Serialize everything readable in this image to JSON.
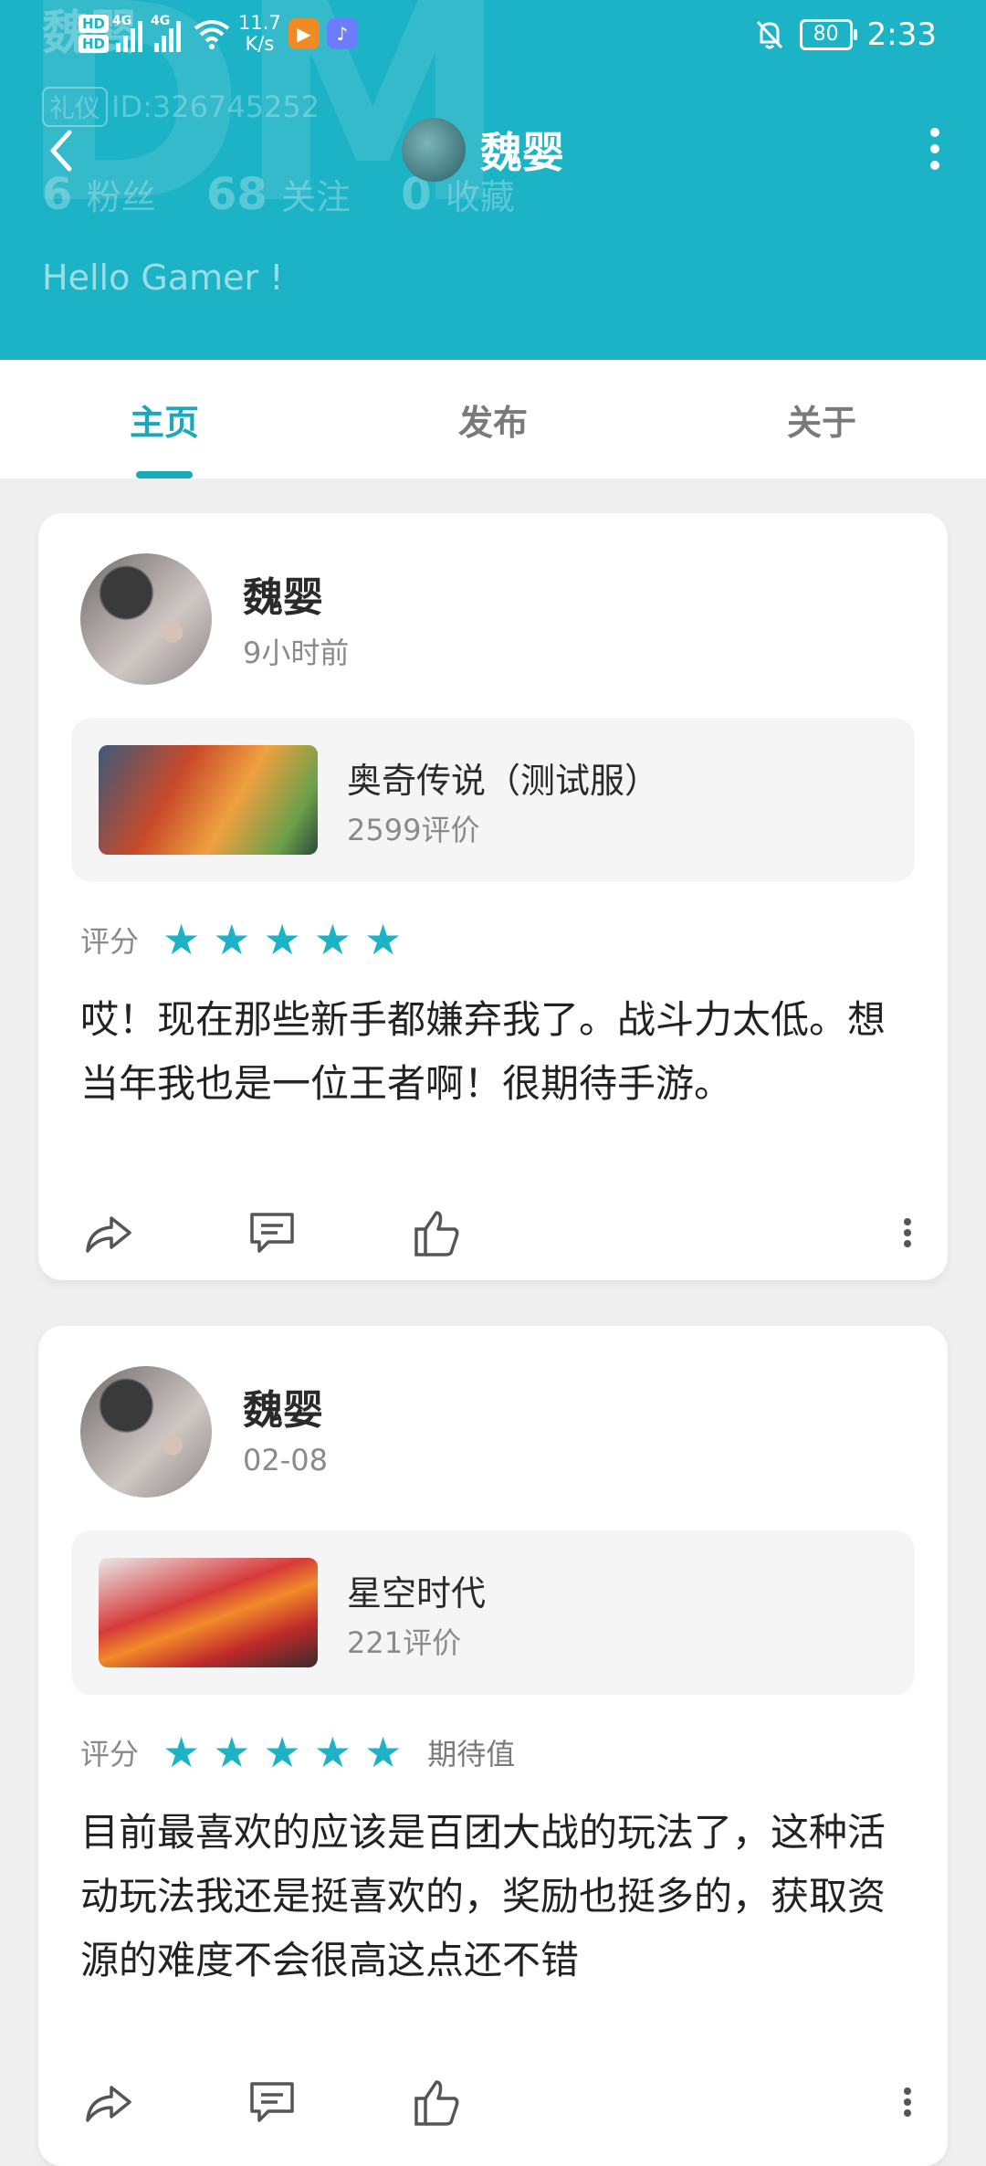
{
  "status_bar": {
    "network_badge": "HD",
    "signal1_label": "4G",
    "signal2_label": "4G",
    "speed_value": "11.7",
    "speed_unit": "K/s",
    "battery": "80",
    "time": "2:33"
  },
  "profile": {
    "name": "魏婴",
    "id_tag": "礼仪",
    "id_text": "ID:326745252",
    "followers_count": "6",
    "followers_label": "粉丝",
    "following_count": "68",
    "following_label": "关注",
    "favorites_count": "0",
    "favorites_label": "收藏",
    "greeting": "Hello Gamer !"
  },
  "topbar": {
    "title": "魏婴"
  },
  "tabs": [
    {
      "label": "主页",
      "active": true
    },
    {
      "label": "发布",
      "active": false
    },
    {
      "label": "关于",
      "active": false
    }
  ],
  "posts": [
    {
      "author": "魏婴",
      "time": "9小时前",
      "game": {
        "name": "奥奇传说（测试服）",
        "reviews": "2599评价"
      },
      "rating_label": "评分",
      "stars": 5,
      "rating_extra": "",
      "text": "哎！现在那些新手都嫌弃我了。战斗力太低。想当年我也是一位王者啊！很期待手游。"
    },
    {
      "author": "魏婴",
      "time": "02-08",
      "game": {
        "name": "星空时代",
        "reviews": "221评价"
      },
      "rating_label": "评分",
      "stars": 5,
      "rating_extra": "期待值",
      "text": "目前最喜欢的应该是百团大战的玩法了，这种活动玩法我还是挺喜欢的，奖励也挺多的，获取资源的难度不会很高这点还不错"
    }
  ],
  "colors": {
    "accent": "#1db3c6",
    "tab_active": "#1aa9ba",
    "background": "#efefef"
  },
  "icons": [
    "back-icon",
    "more-vertical-icon",
    "share-icon",
    "comment-icon",
    "like-icon",
    "star-icon"
  ]
}
